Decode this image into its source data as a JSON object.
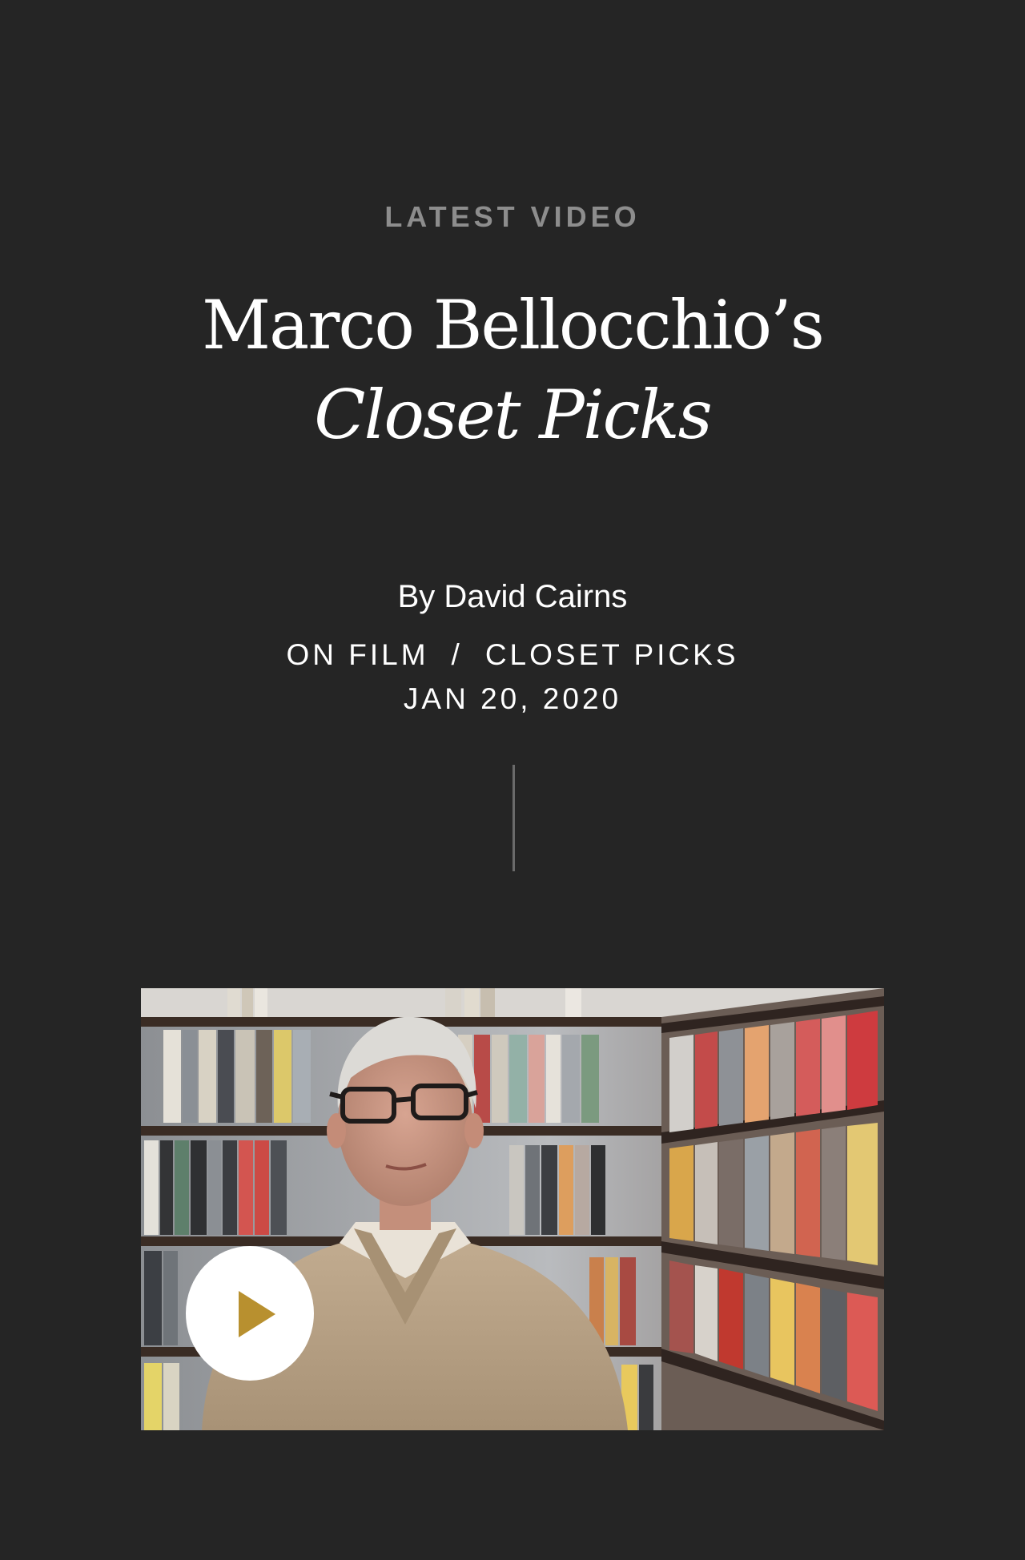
{
  "eyebrow": "LATEST VIDEO",
  "title": {
    "line1": "Marco Bellocchio’s",
    "line2": "Closet Picks"
  },
  "byline": "By David Cairns",
  "categories": [
    {
      "label": "ON FILM"
    },
    {
      "label": "CLOSET PICKS"
    }
  ],
  "category_separator": "/",
  "date": "JAN 20, 2020",
  "video": {
    "play_icon": "play-icon",
    "play_icon_color": "#b8902f"
  },
  "colors": {
    "background": "#252525",
    "eyebrow": "#8d8d8d",
    "accent": "#b8902f"
  }
}
